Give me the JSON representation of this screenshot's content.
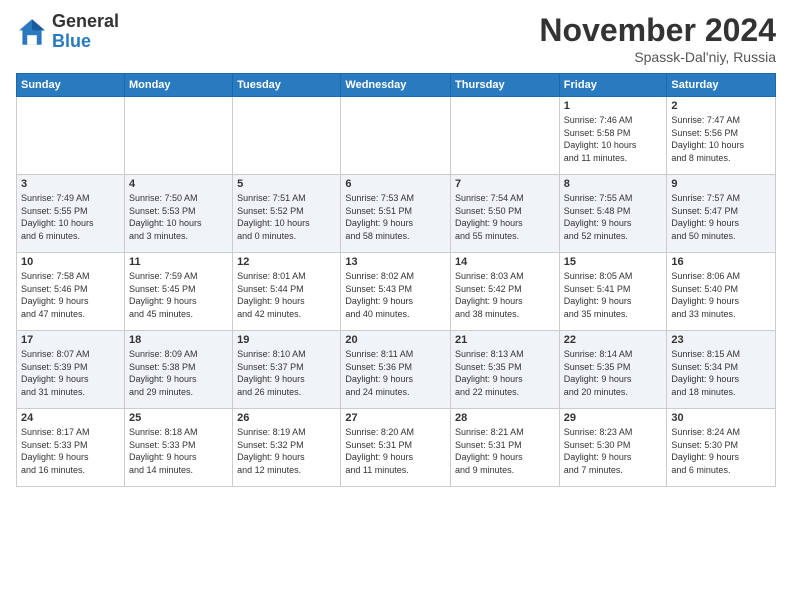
{
  "logo": {
    "general": "General",
    "blue": "Blue"
  },
  "title": {
    "month": "November 2024",
    "location": "Spassk-Dal'niy, Russia"
  },
  "headers": [
    "Sunday",
    "Monday",
    "Tuesday",
    "Wednesday",
    "Thursday",
    "Friday",
    "Saturday"
  ],
  "weeks": [
    [
      {
        "day": "",
        "info": ""
      },
      {
        "day": "",
        "info": ""
      },
      {
        "day": "",
        "info": ""
      },
      {
        "day": "",
        "info": ""
      },
      {
        "day": "",
        "info": ""
      },
      {
        "day": "1",
        "info": "Sunrise: 7:46 AM\nSunset: 5:58 PM\nDaylight: 10 hours\nand 11 minutes."
      },
      {
        "day": "2",
        "info": "Sunrise: 7:47 AM\nSunset: 5:56 PM\nDaylight: 10 hours\nand 8 minutes."
      }
    ],
    [
      {
        "day": "3",
        "info": "Sunrise: 7:49 AM\nSunset: 5:55 PM\nDaylight: 10 hours\nand 6 minutes."
      },
      {
        "day": "4",
        "info": "Sunrise: 7:50 AM\nSunset: 5:53 PM\nDaylight: 10 hours\nand 3 minutes."
      },
      {
        "day": "5",
        "info": "Sunrise: 7:51 AM\nSunset: 5:52 PM\nDaylight: 10 hours\nand 0 minutes."
      },
      {
        "day": "6",
        "info": "Sunrise: 7:53 AM\nSunset: 5:51 PM\nDaylight: 9 hours\nand 58 minutes."
      },
      {
        "day": "7",
        "info": "Sunrise: 7:54 AM\nSunset: 5:50 PM\nDaylight: 9 hours\nand 55 minutes."
      },
      {
        "day": "8",
        "info": "Sunrise: 7:55 AM\nSunset: 5:48 PM\nDaylight: 9 hours\nand 52 minutes."
      },
      {
        "day": "9",
        "info": "Sunrise: 7:57 AM\nSunset: 5:47 PM\nDaylight: 9 hours\nand 50 minutes."
      }
    ],
    [
      {
        "day": "10",
        "info": "Sunrise: 7:58 AM\nSunset: 5:46 PM\nDaylight: 9 hours\nand 47 minutes."
      },
      {
        "day": "11",
        "info": "Sunrise: 7:59 AM\nSunset: 5:45 PM\nDaylight: 9 hours\nand 45 minutes."
      },
      {
        "day": "12",
        "info": "Sunrise: 8:01 AM\nSunset: 5:44 PM\nDaylight: 9 hours\nand 42 minutes."
      },
      {
        "day": "13",
        "info": "Sunrise: 8:02 AM\nSunset: 5:43 PM\nDaylight: 9 hours\nand 40 minutes."
      },
      {
        "day": "14",
        "info": "Sunrise: 8:03 AM\nSunset: 5:42 PM\nDaylight: 9 hours\nand 38 minutes."
      },
      {
        "day": "15",
        "info": "Sunrise: 8:05 AM\nSunset: 5:41 PM\nDaylight: 9 hours\nand 35 minutes."
      },
      {
        "day": "16",
        "info": "Sunrise: 8:06 AM\nSunset: 5:40 PM\nDaylight: 9 hours\nand 33 minutes."
      }
    ],
    [
      {
        "day": "17",
        "info": "Sunrise: 8:07 AM\nSunset: 5:39 PM\nDaylight: 9 hours\nand 31 minutes."
      },
      {
        "day": "18",
        "info": "Sunrise: 8:09 AM\nSunset: 5:38 PM\nDaylight: 9 hours\nand 29 minutes."
      },
      {
        "day": "19",
        "info": "Sunrise: 8:10 AM\nSunset: 5:37 PM\nDaylight: 9 hours\nand 26 minutes."
      },
      {
        "day": "20",
        "info": "Sunrise: 8:11 AM\nSunset: 5:36 PM\nDaylight: 9 hours\nand 24 minutes."
      },
      {
        "day": "21",
        "info": "Sunrise: 8:13 AM\nSunset: 5:35 PM\nDaylight: 9 hours\nand 22 minutes."
      },
      {
        "day": "22",
        "info": "Sunrise: 8:14 AM\nSunset: 5:35 PM\nDaylight: 9 hours\nand 20 minutes."
      },
      {
        "day": "23",
        "info": "Sunrise: 8:15 AM\nSunset: 5:34 PM\nDaylight: 9 hours\nand 18 minutes."
      }
    ],
    [
      {
        "day": "24",
        "info": "Sunrise: 8:17 AM\nSunset: 5:33 PM\nDaylight: 9 hours\nand 16 minutes."
      },
      {
        "day": "25",
        "info": "Sunrise: 8:18 AM\nSunset: 5:33 PM\nDaylight: 9 hours\nand 14 minutes."
      },
      {
        "day": "26",
        "info": "Sunrise: 8:19 AM\nSunset: 5:32 PM\nDaylight: 9 hours\nand 12 minutes."
      },
      {
        "day": "27",
        "info": "Sunrise: 8:20 AM\nSunset: 5:31 PM\nDaylight: 9 hours\nand 11 minutes."
      },
      {
        "day": "28",
        "info": "Sunrise: 8:21 AM\nSunset: 5:31 PM\nDaylight: 9 hours\nand 9 minutes."
      },
      {
        "day": "29",
        "info": "Sunrise: 8:23 AM\nSunset: 5:30 PM\nDaylight: 9 hours\nand 7 minutes."
      },
      {
        "day": "30",
        "info": "Sunrise: 8:24 AM\nSunset: 5:30 PM\nDaylight: 9 hours\nand 6 minutes."
      }
    ]
  ]
}
